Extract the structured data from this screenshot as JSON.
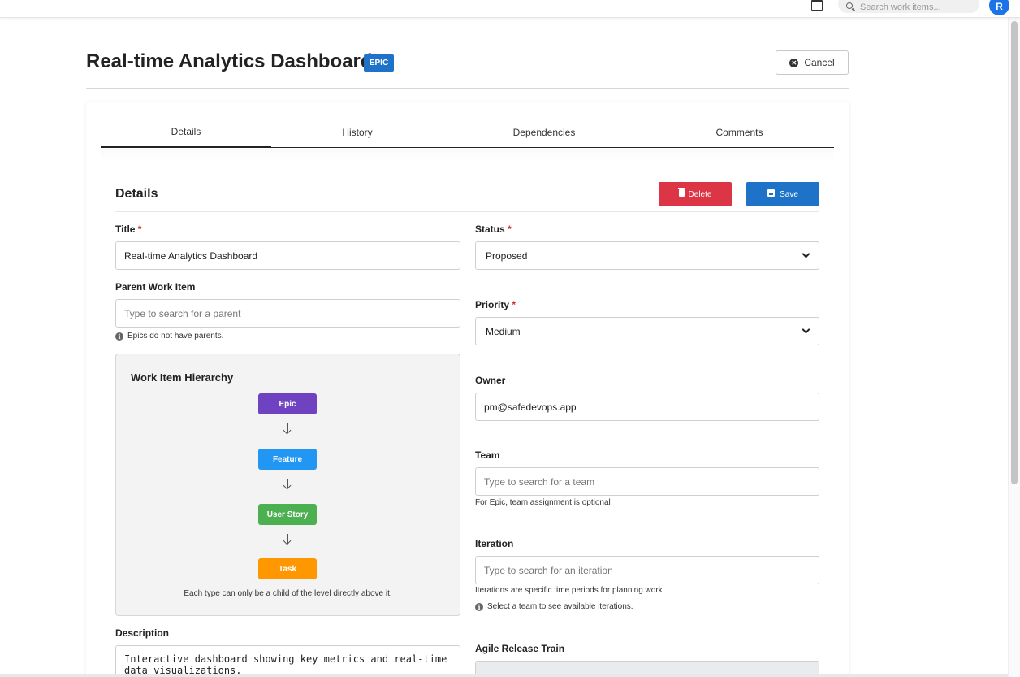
{
  "topbar": {
    "search_placeholder": "Search work items...",
    "avatar_initial": "R"
  },
  "header": {
    "title": "Real-time Analytics Dashboard",
    "type_badge": "EPIC",
    "cancel_label": "Cancel"
  },
  "tabs": [
    {
      "label": "Details",
      "active": true
    },
    {
      "label": "History",
      "active": false
    },
    {
      "label": "Dependencies",
      "active": false
    },
    {
      "label": "Comments",
      "active": false
    }
  ],
  "details": {
    "section_title": "Details",
    "delete_label": "Delete",
    "save_label": "Save",
    "title_label": "Title",
    "title_value": "Real-time Analytics Dashboard",
    "parent_label": "Parent Work Item",
    "parent_placeholder": "Type to search for a parent",
    "parent_hint": "Epics do not have parents.",
    "status_label": "Status",
    "status_value": "Proposed",
    "priority_label": "Priority",
    "priority_value": "Medium",
    "owner_label": "Owner",
    "owner_value": "pm@safedevops.app",
    "team_label": "Team",
    "team_placeholder": "Type to search for a team",
    "team_hint": "For Epic, team assignment is optional",
    "iteration_label": "Iteration",
    "iteration_placeholder": "Type to search for an iteration",
    "iteration_hint": "Iterations are specific time periods for planning work",
    "iteration_info": "Select a team to see available iterations.",
    "description_label": "Description",
    "description_value": "Interactive dashboard showing key metrics and real-time\ndata visualizations.",
    "art_label": "Agile Release Train",
    "required_mark": "*"
  },
  "hierarchy": {
    "title": "Work Item Hierarchy",
    "levels": [
      {
        "label": "Epic",
        "color": "#6f42c1"
      },
      {
        "label": "Feature",
        "color": "#2196f3"
      },
      {
        "label": "User Story",
        "color": "#4caf50"
      },
      {
        "label": "Task",
        "color": "#ff9800"
      }
    ],
    "note": "Each type can only be a child of the level directly above it."
  },
  "colors": {
    "primary": "#1e73c8",
    "danger": "#dc3545"
  }
}
